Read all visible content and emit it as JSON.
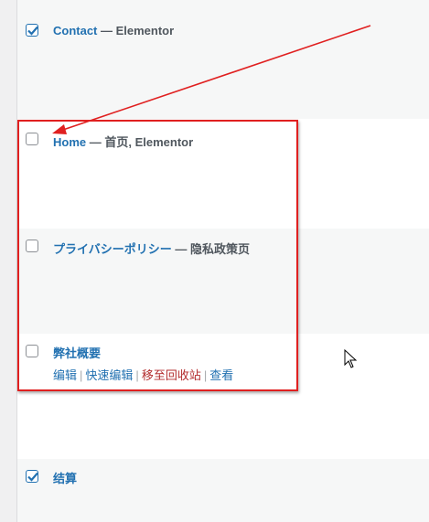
{
  "rows": [
    {
      "title": "Contact",
      "state": " — Elementor",
      "checked": true
    },
    {
      "title": "Home",
      "state": " — 首页, Elementor",
      "checked": false
    },
    {
      "title": "プライバシーポリシー",
      "state": " — 隐私政策页",
      "checked": false
    },
    {
      "title": "弊社概要",
      "state": "",
      "checked": false,
      "actions": {
        "edit": "编辑",
        "quick_edit": "快速编辑",
        "trash": "移至回收站",
        "view": "查看",
        "separator": "|"
      }
    },
    {
      "title": "结算",
      "state": "",
      "checked": true
    }
  ],
  "annotation": {
    "box_color": "#e02020",
    "arrow_color": "#e02020"
  },
  "colors": {
    "link": "#2271b1",
    "trash": "#b32d2e",
    "row_alt": "#f6f7f7"
  }
}
